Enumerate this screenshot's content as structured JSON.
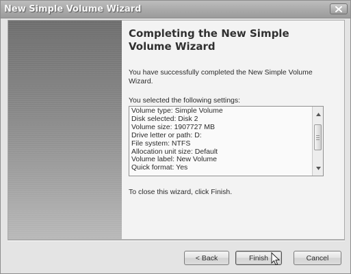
{
  "window": {
    "title": "New Simple Volume Wizard"
  },
  "main": {
    "heading": "Completing the New Simple Volume Wizard",
    "success_text": "You have successfully completed the New Simple Volume Wizard.",
    "settings_label": "You selected the following settings:",
    "settings": [
      "Volume type: Simple Volume",
      "Disk selected: Disk 2",
      "Volume size: 1907727 MB",
      "Drive letter or path: D:",
      "File system: NTFS",
      "Allocation unit size: Default",
      "Volume label: New Volume",
      "Quick format: Yes"
    ],
    "close_text": "To close this wizard, click Finish."
  },
  "buttons": {
    "back": "< Back",
    "finish": "Finish",
    "cancel": "Cancel"
  },
  "icons": {
    "close": "close-icon",
    "scroll_up": "chevron-up-icon",
    "scroll_down": "chevron-down-icon",
    "cursor": "mouse-pointer-icon"
  }
}
